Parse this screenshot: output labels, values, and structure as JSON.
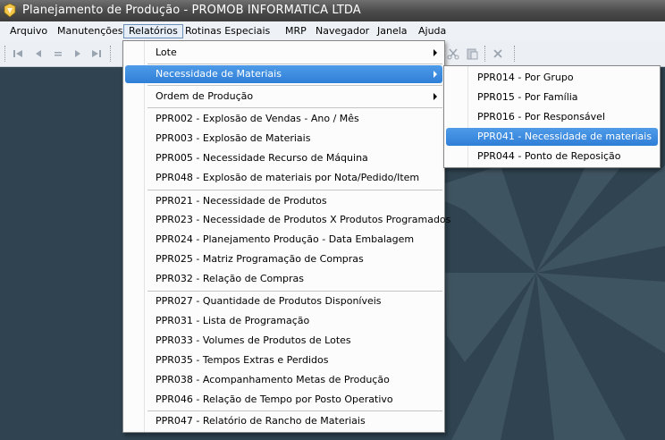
{
  "window": {
    "title": "Planejamento de Produção - PROMOB INFORMATICA LTDA"
  },
  "menubar": {
    "items": [
      {
        "label": "Arquivo"
      },
      {
        "label": "Manutenções"
      },
      {
        "label": "Relatórios"
      },
      {
        "label": "Rotinas Especiais"
      },
      {
        "label": "MRP"
      },
      {
        "label": "Navegador"
      },
      {
        "label": "Janela"
      },
      {
        "label": "Ajuda"
      }
    ]
  },
  "relatorios_menu": {
    "items": [
      {
        "label": "Lote"
      },
      {
        "label": "Necessidade de Materiais"
      },
      {
        "label": "Ordem de Produção"
      },
      {
        "label": "PPR002 -  Explosão de Vendas - Ano / Mês"
      },
      {
        "label": "PPR003 - Explosão de Materiais"
      },
      {
        "label": "PPR005 - Necessidade Recurso de Máquina"
      },
      {
        "label": "PPR048 - Explosão de materiais por Nota/Pedido/Item"
      },
      {
        "label": "PPR021 - Necessidade de Produtos"
      },
      {
        "label": "PPR023 - Necessidade de Produtos X Produtos Programados"
      },
      {
        "label": "PPR024 - Planejamento Produção - Data Embalagem"
      },
      {
        "label": "PPR025 - Matriz Programação de Compras"
      },
      {
        "label": "PPR032 - Relação de Compras"
      },
      {
        "label": "PPR027 - Quantidade de Produtos Disponíveis"
      },
      {
        "label": "PPR031 - Lista de Programação"
      },
      {
        "label": "PPR033 - Volumes de Produtos de Lotes"
      },
      {
        "label": "PPR035 - Tempos Extras e Perdidos"
      },
      {
        "label": "PPR038 - Acompanhamento Metas de Produção"
      },
      {
        "label": "PPR046 - Relação de Tempo por Posto Operativo"
      },
      {
        "label": "PPR047 - Relatório de Rancho de Materiais"
      }
    ]
  },
  "submenu": {
    "items": [
      {
        "label": "PPR014 - Por Grupo"
      },
      {
        "label": "PPR015 - Por Família"
      },
      {
        "label": "PPR016 - Por Responsável"
      },
      {
        "label": "PPR041 - Necessidade de materiais"
      },
      {
        "label": "PPR044 - Ponto de Reposição"
      }
    ]
  },
  "colors": {
    "workspace": "#2f4350",
    "highlight": "#3b8ce0",
    "menubar": "#eef1f5"
  }
}
